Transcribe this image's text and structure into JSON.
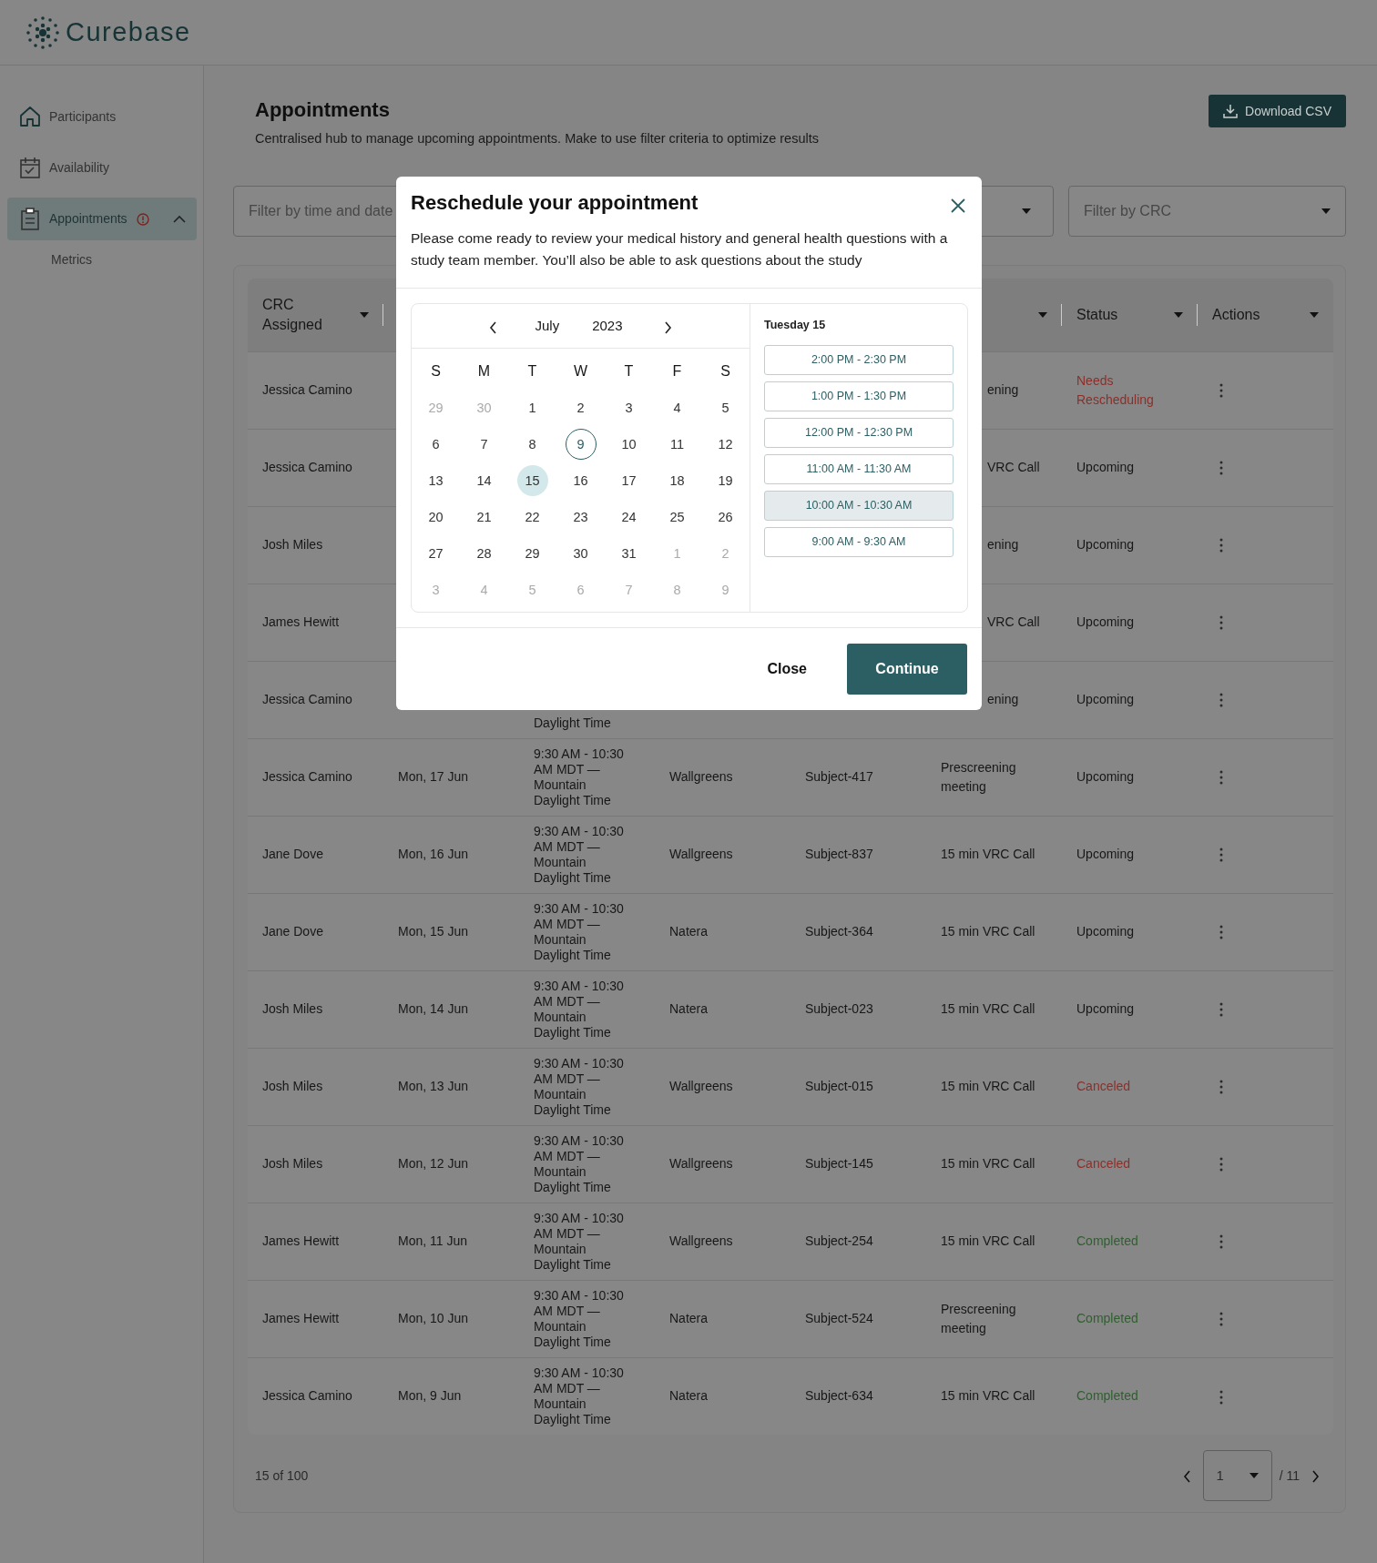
{
  "app": {
    "logo": "Curebase"
  },
  "sidebar": {
    "items": [
      {
        "label": "Participants",
        "selected": false
      },
      {
        "label": "Availability",
        "selected": false
      },
      {
        "label": "Appointments",
        "selected": true,
        "alert": true,
        "expanded": true,
        "children": [
          {
            "label": "Metrics",
            "selected": false
          }
        ]
      }
    ]
  },
  "page": {
    "title": "Appointments",
    "subtitle": "Centralised hub to manage upcoming appointments. Make to use filter criteria to optimize results",
    "download_button": "Download CSV"
  },
  "filters": [
    {
      "placeholder": "Filter by time and date"
    },
    {
      "placeholder": "Filter by CRC"
    }
  ],
  "table": {
    "columns": [
      {
        "label": "CRC Assigned",
        "sort": true
      },
      null,
      null,
      null,
      null,
      {
        "sort": true
      },
      {
        "label": "Status",
        "sort": true
      },
      {
        "label": "Actions",
        "sort": true
      }
    ],
    "rows": [
      {
        "cells": [
          "Jessica Camino",
          null,
          null,
          null,
          null,
          "ening",
          "Needs Rescheduling"
        ],
        "color": "#8c2f2a"
      },
      {
        "cells": [
          "Jessica Camino",
          null,
          null,
          null,
          null,
          "VRC Call",
          "Upcoming"
        ],
        "color": "#171717"
      },
      {
        "cells": [
          "Josh Miles",
          null,
          null,
          null,
          null,
          "ening",
          "Upcoming"
        ],
        "color": "#171717"
      },
      {
        "cells": [
          "James Hewitt",
          null,
          null,
          null,
          null,
          "VRC Call",
          "Upcoming"
        ],
        "color": "#171717"
      },
      {
        "cells": [
          "Jessica Camino",
          null,
          "Daylight Time",
          null,
          null,
          "ening",
          "Upcoming"
        ],
        "color": "#171717"
      },
      {
        "cells": [
          "Jessica Camino",
          "Mon, 17 Jun",
          "9:30 AM - 10:30 AM MDT — Mountain Daylight Time",
          "Wallgreens",
          "Subject-417",
          "Prescreening meeting",
          "Upcoming"
        ],
        "color": "#171717"
      },
      {
        "cells": [
          "Jane Dove",
          "Mon, 16 Jun",
          "9:30 AM - 10:30 AM MDT — Mountain Daylight Time",
          "Wallgreens",
          "Subject-837",
          "15 min VRC Call",
          "Upcoming"
        ],
        "color": "#171717"
      },
      {
        "cells": [
          "Jane Dove",
          "Mon, 15 Jun",
          "9:30 AM - 10:30 AM MDT — Mountain Daylight Time",
          "Natera",
          "Subject-364",
          "15 min VRC Call",
          "Upcoming"
        ],
        "color": "#171717"
      },
      {
        "cells": [
          "Josh Miles",
          "Mon, 14 Jun",
          "9:30 AM - 10:30 AM MDT — Mountain Daylight Time",
          "Natera",
          "Subject-023",
          "15 min VRC Call",
          "Upcoming"
        ],
        "color": "#171717"
      },
      {
        "cells": [
          "Josh Miles",
          "Mon, 13 Jun",
          "9:30 AM - 10:30 AM MDT — Mountain Daylight Time",
          "Wallgreens",
          "Subject-015",
          "15 min VRC Call",
          "Canceled"
        ],
        "color": "#8c2f2a"
      },
      {
        "cells": [
          "Josh Miles",
          "Mon, 12 Jun",
          "9:30 AM - 10:30 AM MDT — Mountain Daylight Time",
          "Wallgreens",
          "Subject-145",
          "15 min VRC Call",
          "Canceled"
        ],
        "color": "#8c2f2a"
      },
      {
        "cells": [
          "James Hewitt",
          "Mon, 11 Jun",
          "9:30 AM - 10:30 AM MDT — Mountain Daylight Time",
          "Wallgreens",
          "Subject-254",
          "15 min VRC Call",
          "Completed"
        ],
        "color": "#2f5f2f"
      },
      {
        "cells": [
          "James Hewitt",
          "Mon, 10 Jun",
          "9:30 AM - 10:30 AM MDT — Mountain Daylight Time",
          "Natera",
          "Subject-524",
          "Prescreening meeting",
          "Completed"
        ],
        "color": "#2f5f2f"
      },
      {
        "cells": [
          "Jessica Camino",
          "Mon, 9 Jun",
          "9:30 AM - 10:30 AM MDT — Mountain Daylight Time",
          "Natera",
          "Subject-634",
          "15 min VRC Call",
          "Completed"
        ],
        "color": "#2f5f2f"
      }
    ]
  },
  "pagination": {
    "count": "15 of 100",
    "page": "1",
    "total": "/ 11"
  },
  "dialog": {
    "title": "Reschedule your appointment",
    "text": "Please come ready to review your medical history and general health questions with a study team member. You’ll also be able to ask questions about the study",
    "calendar": {
      "month": "July",
      "year": "2023",
      "weekdays": [
        "S",
        "M",
        "T",
        "W",
        "T",
        "F",
        "S"
      ],
      "weeks": [
        [
          {
            "day": "29",
            "outside": true,
            "today": false,
            "selected": false
          },
          {
            "day": "30",
            "outside": true,
            "today": false,
            "selected": false
          },
          {
            "day": "1",
            "outside": false,
            "today": false,
            "selected": false
          },
          {
            "day": "2",
            "outside": false,
            "today": false,
            "selected": false
          },
          {
            "day": "3",
            "outside": false,
            "today": false,
            "selected": false
          },
          {
            "day": "4",
            "outside": false,
            "today": false,
            "selected": false
          },
          {
            "day": "5",
            "outside": false,
            "today": false,
            "selected": false
          }
        ],
        [
          {
            "day": "6",
            "outside": false,
            "today": false,
            "selected": false
          },
          {
            "day": "7",
            "outside": false,
            "today": false,
            "selected": false
          },
          {
            "day": "8",
            "outside": false,
            "today": false,
            "selected": false
          },
          {
            "day": "9",
            "outside": false,
            "today": true,
            "selected": false
          },
          {
            "day": "10",
            "outside": false,
            "today": false,
            "selected": false
          },
          {
            "day": "11",
            "outside": false,
            "today": false,
            "selected": false
          },
          {
            "day": "12",
            "outside": false,
            "today": false,
            "selected": false
          }
        ],
        [
          {
            "day": "13",
            "outside": false,
            "today": false,
            "selected": false
          },
          {
            "day": "14",
            "outside": false,
            "today": false,
            "selected": false
          },
          {
            "day": "15",
            "outside": false,
            "today": false,
            "selected": true
          },
          {
            "day": "16",
            "outside": false,
            "today": false,
            "selected": false
          },
          {
            "day": "17",
            "outside": false,
            "today": false,
            "selected": false
          },
          {
            "day": "18",
            "outside": false,
            "today": false,
            "selected": false
          },
          {
            "day": "19",
            "outside": false,
            "today": false,
            "selected": false
          }
        ],
        [
          {
            "day": "20",
            "outside": false,
            "today": false,
            "selected": false
          },
          {
            "day": "21",
            "outside": false,
            "today": false,
            "selected": false
          },
          {
            "day": "22",
            "outside": false,
            "today": false,
            "selected": false
          },
          {
            "day": "23",
            "outside": false,
            "today": false,
            "selected": false
          },
          {
            "day": "24",
            "outside": false,
            "today": false,
            "selected": false
          },
          {
            "day": "25",
            "outside": false,
            "today": false,
            "selected": false
          },
          {
            "day": "26",
            "outside": false,
            "today": false,
            "selected": false
          }
        ],
        [
          {
            "day": "27",
            "outside": false,
            "today": false,
            "selected": false
          },
          {
            "day": "28",
            "outside": false,
            "today": false,
            "selected": false
          },
          {
            "day": "29",
            "outside": false,
            "today": false,
            "selected": false
          },
          {
            "day": "30",
            "outside": false,
            "today": false,
            "selected": false
          },
          {
            "day": "31",
            "outside": false,
            "today": false,
            "selected": false
          },
          {
            "day": "1",
            "outside": true,
            "today": false,
            "selected": false
          },
          {
            "day": "2",
            "outside": true,
            "today": false,
            "selected": false
          }
        ],
        [
          {
            "day": "3",
            "outside": true,
            "today": false,
            "selected": false
          },
          {
            "day": "4",
            "outside": true,
            "today": false,
            "selected": false
          },
          {
            "day": "5",
            "outside": true,
            "today": false,
            "selected": false
          },
          {
            "day": "6",
            "outside": true,
            "today": false,
            "selected": false
          },
          {
            "day": "7",
            "outside": true,
            "today": false,
            "selected": false
          },
          {
            "day": "8",
            "outside": true,
            "today": false,
            "selected": false
          },
          {
            "day": "9",
            "outside": true,
            "today": false,
            "selected": false
          }
        ]
      ]
    },
    "slots_heading": "Tuesday 15",
    "slots": [
      {
        "label": "2:00 PM - 2:30 PM",
        "selected": false
      },
      {
        "label": "1:00 PM - 1:30 PM",
        "selected": false
      },
      {
        "label": "12:00 PM - 12:30 PM",
        "selected": false
      },
      {
        "label": "11:00 AM - 11:30 AM",
        "selected": false
      },
      {
        "label": "10:00 AM - 10:30 AM",
        "selected": true
      },
      {
        "label": "9:00 AM - 9:30 AM",
        "selected": false
      }
    ],
    "buttons": [
      "Close",
      "Continue"
    ]
  }
}
